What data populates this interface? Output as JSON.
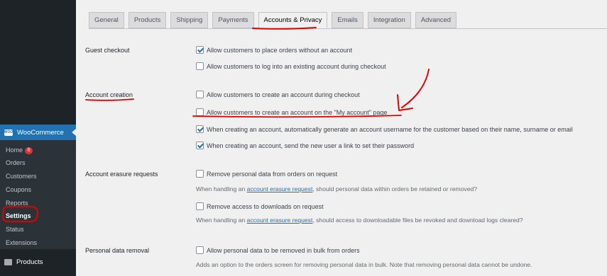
{
  "sidebar": {
    "woo_title": "WooCommerce",
    "woo_logo": "WOO",
    "items": [
      {
        "label": "Home",
        "badge": "6"
      },
      {
        "label": "Orders"
      },
      {
        "label": "Customers"
      },
      {
        "label": "Coupons"
      },
      {
        "label": "Reports"
      },
      {
        "label": "Settings",
        "active": true
      },
      {
        "label": "Status"
      },
      {
        "label": "Extensions"
      }
    ],
    "products": "Products"
  },
  "tabs": [
    "General",
    "Products",
    "Shipping",
    "Payments",
    "Accounts & Privacy",
    "Emails",
    "Integration",
    "Advanced"
  ],
  "active_tab": "Accounts & Privacy",
  "sections": {
    "guest": {
      "label": "Guest checkout",
      "opt1": "Allow customers to place orders without an account",
      "opt2": "Allow customers to log into an existing account during checkout"
    },
    "creation": {
      "label": "Account creation",
      "opt1": "Allow customers to create an account during checkout",
      "opt2": "Allow customers to create an account on the \"My account\" page",
      "opt3": "When creating an account, automatically generate an account username for the customer based on their name, surname or email",
      "opt4": "When creating an account, send the new user a link to set their password"
    },
    "erasure": {
      "label": "Account erasure requests",
      "opt1": "Remove personal data from orders on request",
      "desc1_pre": "When handling an ",
      "desc1_link": "account erasure request",
      "desc1_post": ", should personal data within orders be retained or removed?",
      "opt2": "Remove access to downloads on request",
      "desc2_pre": "When handling an ",
      "desc2_link": "account erasure request",
      "desc2_post": ", should access to downloadable files be revoked and download logs cleared?"
    },
    "removal": {
      "label": "Personal data removal",
      "opt1": "Allow personal data to be removed in bulk from orders",
      "desc1": "Adds an option to the orders screen for removing personal data in bulk. Note that removing personal data cannot be undone."
    }
  },
  "checkbox_states": {
    "guest_opt1": true,
    "guest_opt2": false,
    "creation_opt1": false,
    "creation_opt2": false,
    "creation_opt3": true,
    "creation_opt4": true,
    "erasure_opt1": false,
    "erasure_opt2": false,
    "removal_opt1": false
  },
  "colors": {
    "accent": "#2271b1",
    "annotation": "#e00000",
    "sidebar": "#1d2327"
  }
}
